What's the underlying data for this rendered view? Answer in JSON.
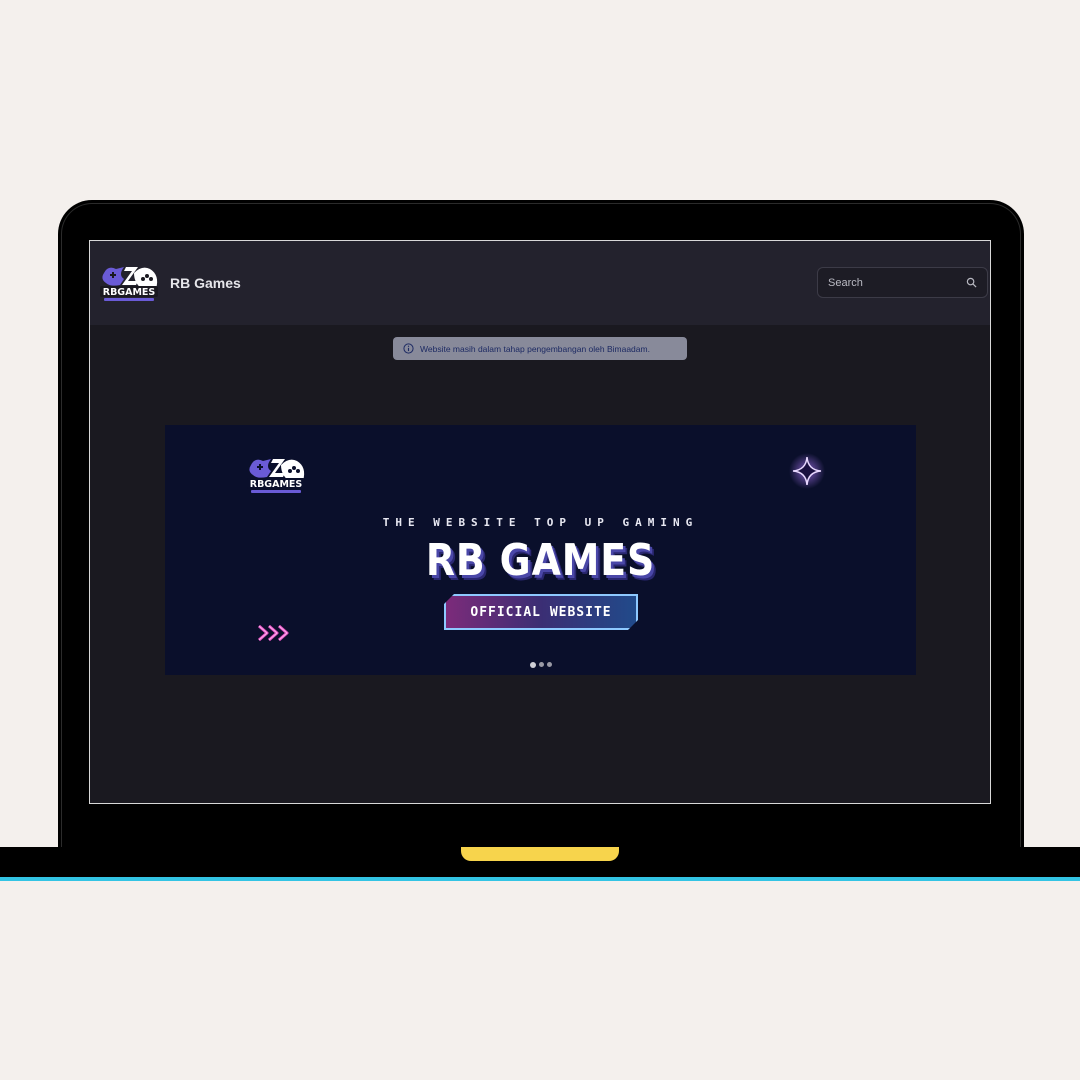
{
  "header": {
    "logo_text": "RBGAMES",
    "brand_name": "RB Games",
    "search": {
      "placeholder": "Search",
      "value": ""
    }
  },
  "alert": {
    "icon": "info-icon",
    "message": "Website masih dalam tahap pengembangan oleh Bimaadam."
  },
  "banner": {
    "logo_text": "RBGAMES",
    "tagline": "THE WEBSITE TOP UP GAMING",
    "title": "RB GAMES",
    "badge": "OFFICIAL WEBSITE",
    "slides_total": 3,
    "active_slide": 1
  },
  "colors": {
    "page_background": "#f4f0ed",
    "screen_background": "#1a1920",
    "navbar_background": "#23222d",
    "banner_background": "#0a0f2b",
    "accent_purple": "#6a5bd6",
    "accent_pink": "#e24fc0",
    "base_line": "#33c4e4",
    "notch": "#f7d44c"
  }
}
